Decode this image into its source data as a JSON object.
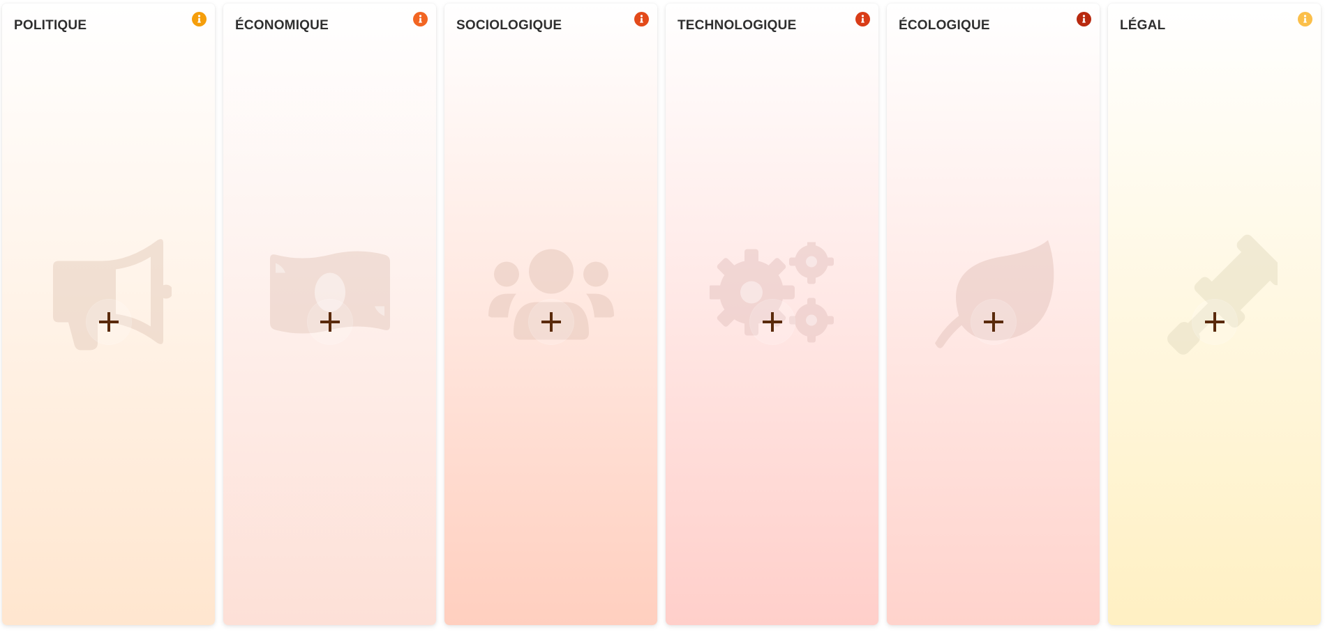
{
  "columns": [
    {
      "key": "politique",
      "title": "POLITIQUE",
      "icon": "megaphone-icon",
      "accent": "#f59e0b",
      "gradient_top": "#ffffff",
      "gradient_bottom": "#ffe6cf",
      "icon_color": "#e6cfc0"
    },
    {
      "key": "economique",
      "title": "ÉCONOMIQUE",
      "icon": "money-bill-icon",
      "accent": "#f26522",
      "gradient_top": "#ffffff",
      "gradient_bottom": "#fde0d7",
      "icon_color": "#e7cdc3"
    },
    {
      "key": "sociologique",
      "title": "SOCIOLOGIQUE",
      "icon": "users-icon",
      "accent": "#e34a1a",
      "gradient_top": "#ffffff",
      "gradient_bottom": "#ffcfbf",
      "icon_color": "#e7c9bd"
    },
    {
      "key": "technologique",
      "title": "TECHNOLOGIQUE",
      "icon": "gears-icon",
      "accent": "#d93c17",
      "gradient_top": "#ffffff",
      "gradient_bottom": "#ffcfca",
      "icon_color": "#e7c6c3"
    },
    {
      "key": "ecologique",
      "title": "ÉCOLOGIQUE",
      "icon": "leaf-icon",
      "accent": "#b8290f",
      "gradient_top": "#ffffff",
      "gradient_bottom": "#ffd3cc",
      "icon_color": "#e7c7c0"
    },
    {
      "key": "legal",
      "title": "LÉGAL",
      "icon": "gavel-icon",
      "accent": "#fbbf4a",
      "gradient_top": "#ffffff",
      "gradient_bottom": "#fff0c3",
      "icon_color": "#e7dfc4"
    }
  ],
  "add_button": {
    "symbol": "+",
    "color": "#5a2a0b"
  }
}
